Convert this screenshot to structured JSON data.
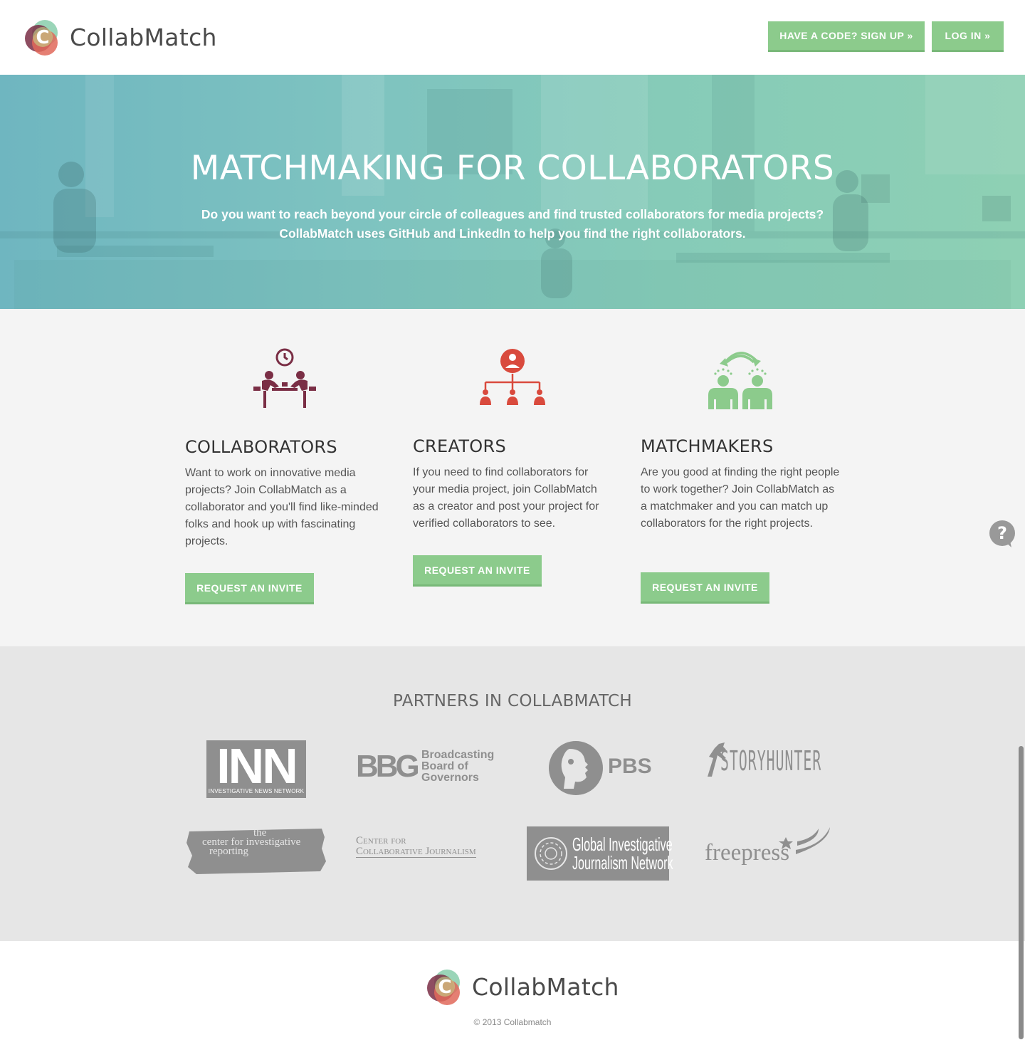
{
  "header": {
    "brand_name": "CollabMatch",
    "signup_label": "HAVE A CODE? SIGN UP »",
    "login_label": "LOG IN »"
  },
  "hero": {
    "title": "MATCHMAKING FOR COLLABORATORS",
    "subtitle_line1": "Do you want to reach beyond your circle of colleagues and find trusted collaborators for media projects?",
    "subtitle_line2": "CollabMatch uses GitHub and LinkedIn to help you find the right collaborators."
  },
  "features": [
    {
      "icon": "meeting-icon",
      "title": "COLLABORATORS",
      "text": "Want to work on innovative media projects? Join CollabMatch as a collaborator and you'll find like-minded folks and hook up with fascinating projects.",
      "button": "REQUEST AN INVITE"
    },
    {
      "icon": "org-chart-icon",
      "title": "CREATORS",
      "text": "If you need to find collaborators for your media project, join CollabMatch as a creator and post your project for verified collaborators to see.",
      "button": "REQUEST AN INVITE"
    },
    {
      "icon": "exchange-icon",
      "title": "MATCHMAKERS",
      "text": "Are you good at finding the right people to work together? Join CollabMatch as a matchmaker and you can match up collaborators for the right projects.",
      "button": "REQUEST AN INVITE"
    }
  ],
  "partners": {
    "title": "PARTNERS IN COLLABMATCH",
    "logos": {
      "inn": {
        "main": "INN",
        "sub": "INVESTIGATIVE NEWS NETWORK"
      },
      "bbg": {
        "mark": "BBG",
        "line1": "Broadcasting",
        "line2": "Board of",
        "line3": "Governors"
      },
      "pbs": {
        "text": "PBS"
      },
      "storyhunter": {
        "text": "STORYHUNTER"
      },
      "cir": {
        "line1": "the",
        "line2": "center for investigative",
        "line3": "reporting"
      },
      "ccj": {
        "line1": "Center for",
        "line2": "Collaborative Journalism"
      },
      "gijn": {
        "line1": "Global Investigative",
        "line2": "Journalism Network"
      },
      "freepress": {
        "text": "freepress"
      }
    }
  },
  "footer": {
    "brand_name": "CollabMatch",
    "copyright": "© 2013 Collabmatch"
  },
  "colors": {
    "accent_green": "#8ccb8c",
    "icon_maroon": "#7a2e45",
    "icon_red": "#d94a3d",
    "icon_green": "#8ccb8c"
  }
}
